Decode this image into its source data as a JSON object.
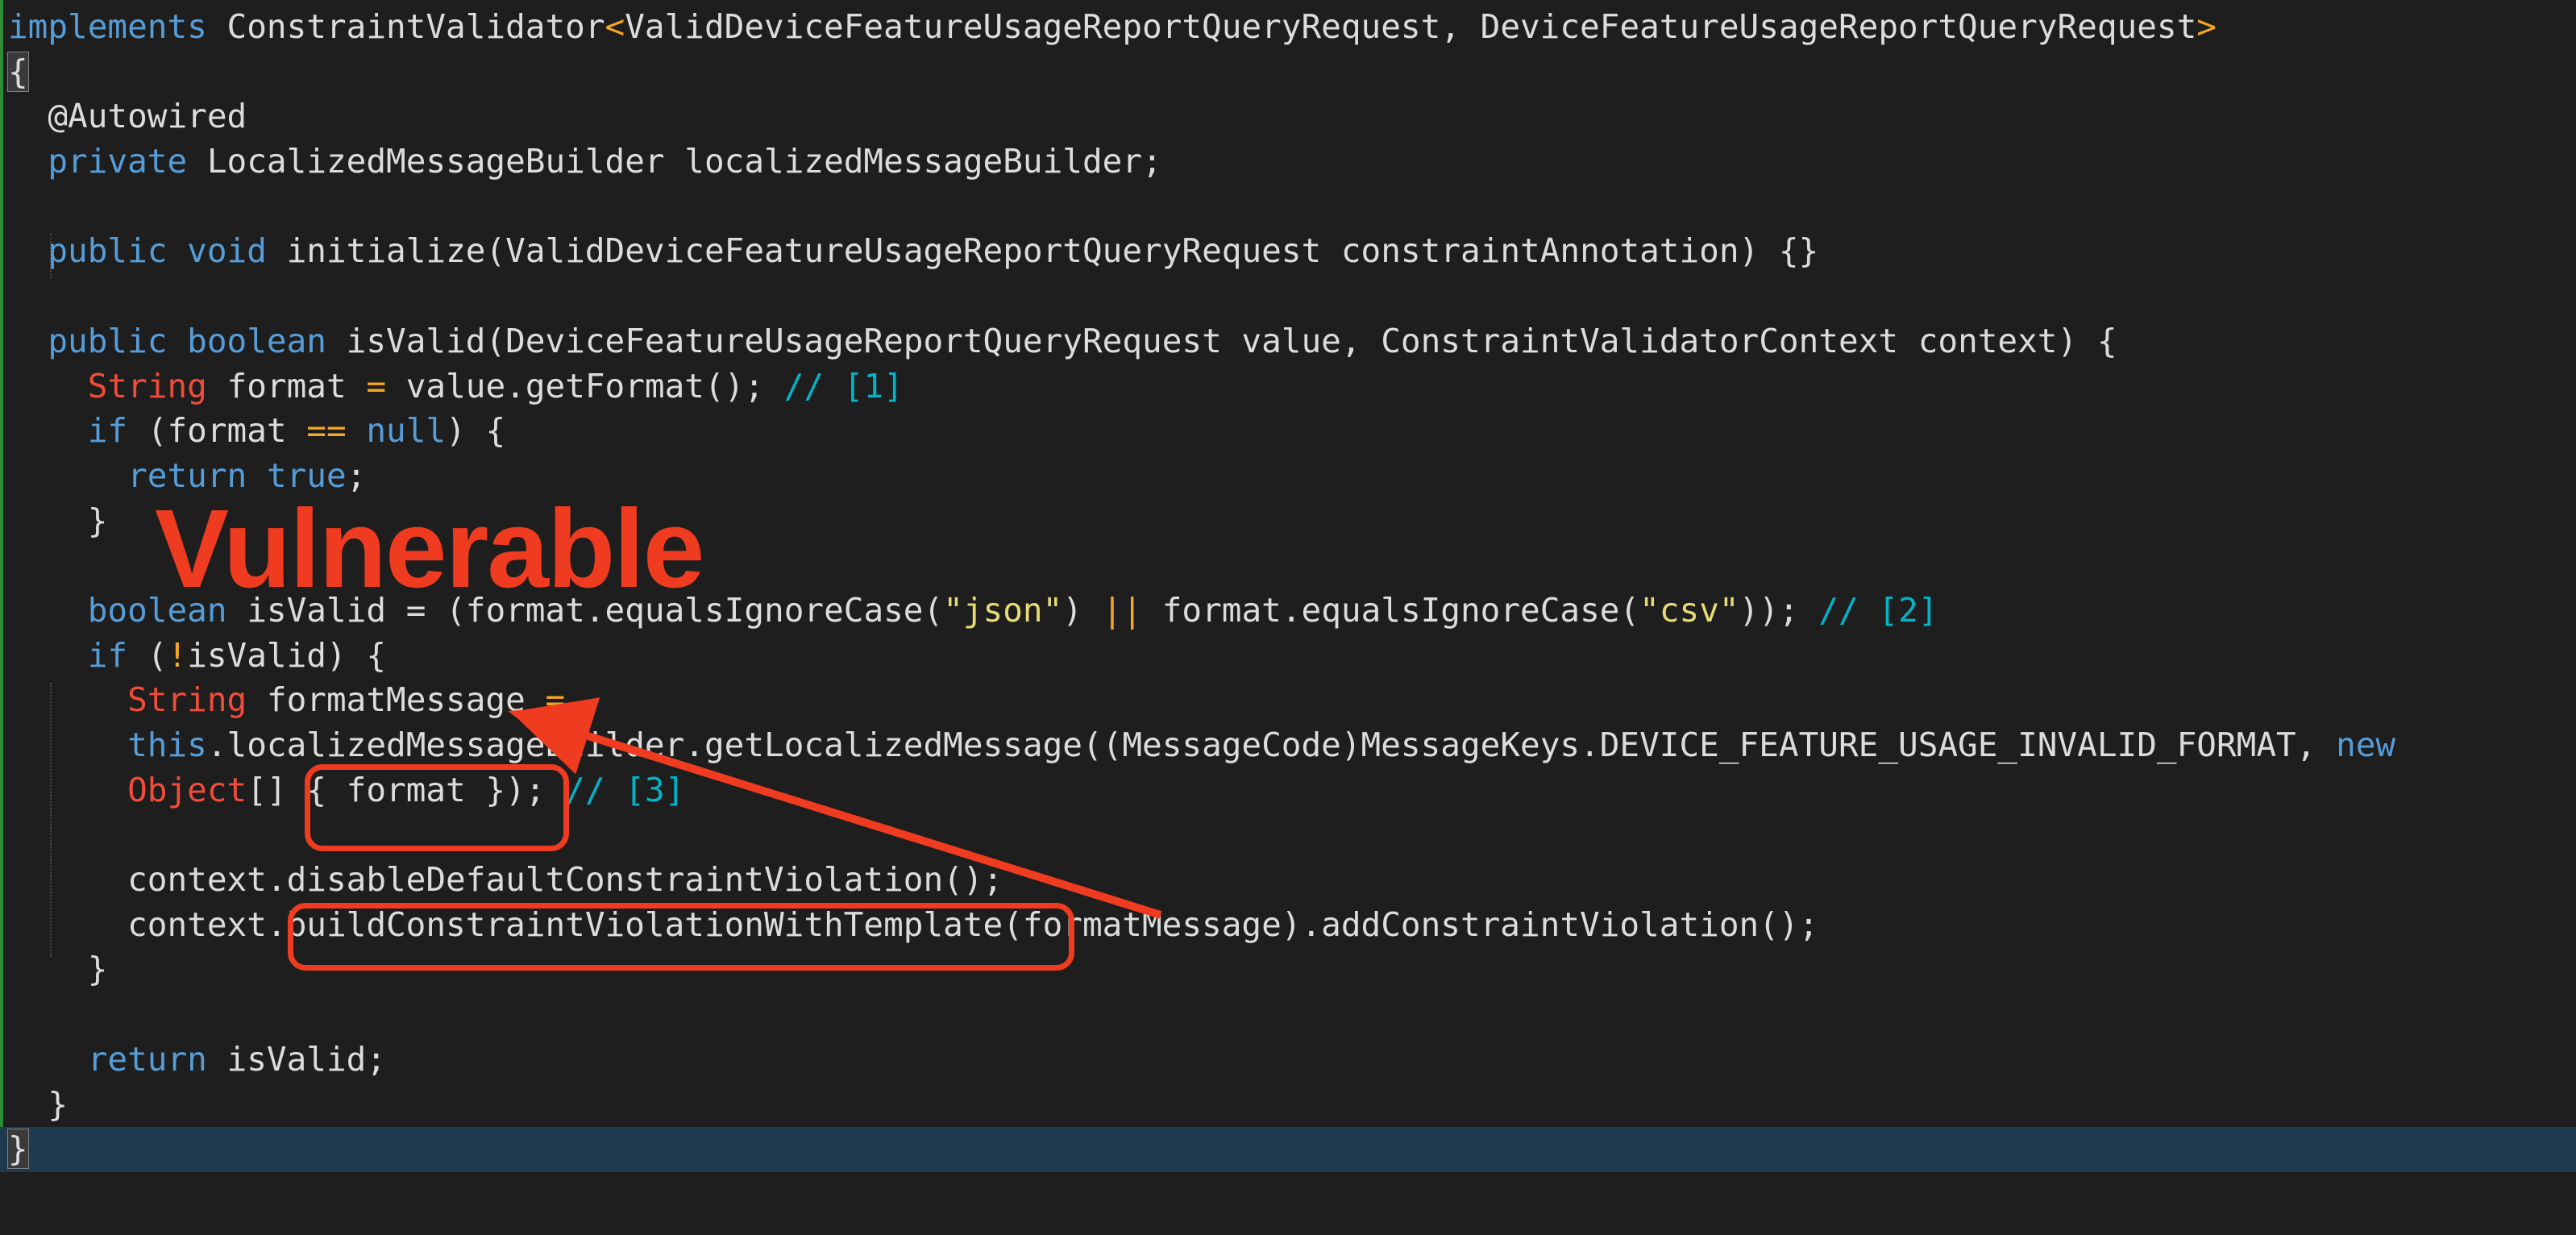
{
  "editor": {
    "lines": [
      [
        {
          "t": "implements",
          "c": "kw"
        },
        {
          "t": " ConstraintValidator",
          "c": ""
        },
        {
          "t": "<",
          "c": "op"
        },
        {
          "t": "ValidDeviceFeatureUsageReportQueryRequest, DeviceFeatureUsageReportQueryRequest",
          "c": ""
        },
        {
          "t": ">",
          "c": "op"
        }
      ],
      [
        {
          "t": "{",
          "c": "brace"
        }
      ],
      [
        {
          "t": "  @Autowired",
          "c": ""
        }
      ],
      [
        {
          "t": "  ",
          "c": ""
        },
        {
          "t": "private",
          "c": "kw"
        },
        {
          "t": " LocalizedMessageBuilder localizedMessageBuilder;",
          "c": ""
        }
      ],
      [
        {
          "t": "",
          "c": ""
        }
      ],
      [
        {
          "t": "  ",
          "c": ""
        },
        {
          "t": "public",
          "c": "kw"
        },
        {
          "t": " ",
          "c": ""
        },
        {
          "t": "void",
          "c": "kw"
        },
        {
          "t": " initialize(ValidDeviceFeatureUsageReportQueryRequest constraintAnnotation) {}",
          "c": ""
        }
      ],
      [
        {
          "t": "",
          "c": ""
        }
      ],
      [
        {
          "t": "  ",
          "c": ""
        },
        {
          "t": "public",
          "c": "kw"
        },
        {
          "t": " ",
          "c": ""
        },
        {
          "t": "boolean",
          "c": "kw"
        },
        {
          "t": " isValid(DeviceFeatureUsageReportQueryRequest value, ConstraintValidatorContext context) {",
          "c": ""
        }
      ],
      [
        {
          "t": "    ",
          "c": ""
        },
        {
          "t": "String",
          "c": "ty"
        },
        {
          "t": " format ",
          "c": ""
        },
        {
          "t": "=",
          "c": "op"
        },
        {
          "t": " value.getFormat(); ",
          "c": ""
        },
        {
          "t": "// [1]",
          "c": "cm"
        }
      ],
      [
        {
          "t": "    ",
          "c": ""
        },
        {
          "t": "if",
          "c": "kw"
        },
        {
          "t": " (format ",
          "c": ""
        },
        {
          "t": "==",
          "c": "op"
        },
        {
          "t": " ",
          "c": ""
        },
        {
          "t": "null",
          "c": "kw"
        },
        {
          "t": ") {",
          "c": ""
        }
      ],
      [
        {
          "t": "      ",
          "c": ""
        },
        {
          "t": "return",
          "c": "kw"
        },
        {
          "t": " ",
          "c": ""
        },
        {
          "t": "true",
          "c": "kw"
        },
        {
          "t": ";",
          "c": ""
        }
      ],
      [
        {
          "t": "    }",
          "c": ""
        }
      ],
      [
        {
          "t": "",
          "c": ""
        }
      ],
      [
        {
          "t": "    ",
          "c": ""
        },
        {
          "t": "boolean",
          "c": "kw"
        },
        {
          "t": " isValid = (format.equalsIgnoreCase(",
          "c": ""
        },
        {
          "t": "\"json\"",
          "c": "str"
        },
        {
          "t": ") ",
          "c": ""
        },
        {
          "t": "||",
          "c": "op"
        },
        {
          "t": " format.equalsIgnoreCase(",
          "c": ""
        },
        {
          "t": "\"csv\"",
          "c": "str"
        },
        {
          "t": ")); ",
          "c": ""
        },
        {
          "t": "// [2]",
          "c": "cm"
        }
      ],
      [
        {
          "t": "    ",
          "c": ""
        },
        {
          "t": "if",
          "c": "kw"
        },
        {
          "t": " (",
          "c": ""
        },
        {
          "t": "!",
          "c": "op"
        },
        {
          "t": "isValid) {",
          "c": ""
        }
      ],
      [
        {
          "t": "      ",
          "c": ""
        },
        {
          "t": "String",
          "c": "ty"
        },
        {
          "t": " formatMessage ",
          "c": ""
        },
        {
          "t": "=",
          "c": "op"
        }
      ],
      [
        {
          "t": "      ",
          "c": ""
        },
        {
          "t": "this",
          "c": "kw"
        },
        {
          "t": ".localizedMessageBuilder.getLocalizedMessage((MessageCode)MessageKeys.DEVICE_FEATURE_USAGE_INVALID_FORMAT, ",
          "c": ""
        },
        {
          "t": "new",
          "c": "kw"
        }
      ],
      [
        {
          "t": "      ",
          "c": ""
        },
        {
          "t": "Object",
          "c": "ty"
        },
        {
          "t": "[] { format }); ",
          "c": ""
        },
        {
          "t": "// [3]",
          "c": "cm"
        }
      ],
      [
        {
          "t": "",
          "c": ""
        }
      ],
      [
        {
          "t": "      context.disableDefaultConstraintViolation();",
          "c": ""
        }
      ],
      [
        {
          "t": "      context.buildConstraintViolationWithTemplate(formatMessage).addConstraintViolation();",
          "c": ""
        }
      ],
      [
        {
          "t": "    }",
          "c": ""
        }
      ],
      [
        {
          "t": "",
          "c": ""
        }
      ],
      [
        {
          "t": "    ",
          "c": ""
        },
        {
          "t": "return",
          "c": "kw"
        },
        {
          "t": " isValid;",
          "c": ""
        }
      ],
      [
        {
          "t": "  }",
          "c": ""
        }
      ],
      [
        {
          "t": "}",
          "c": "brace"
        }
      ]
    ],
    "current_line": 25
  },
  "annotation": {
    "label": "Vulnerable",
    "color": "#ef3b1f"
  },
  "colors": {
    "background": "#1e1e1e",
    "keyword": "#569cd6",
    "type": "#f14c3a",
    "operator": "#f5a623",
    "string": "#e6db74",
    "comment": "#00b4c8",
    "text": "#dcdcdc",
    "current_line": "#1f3a4f"
  }
}
